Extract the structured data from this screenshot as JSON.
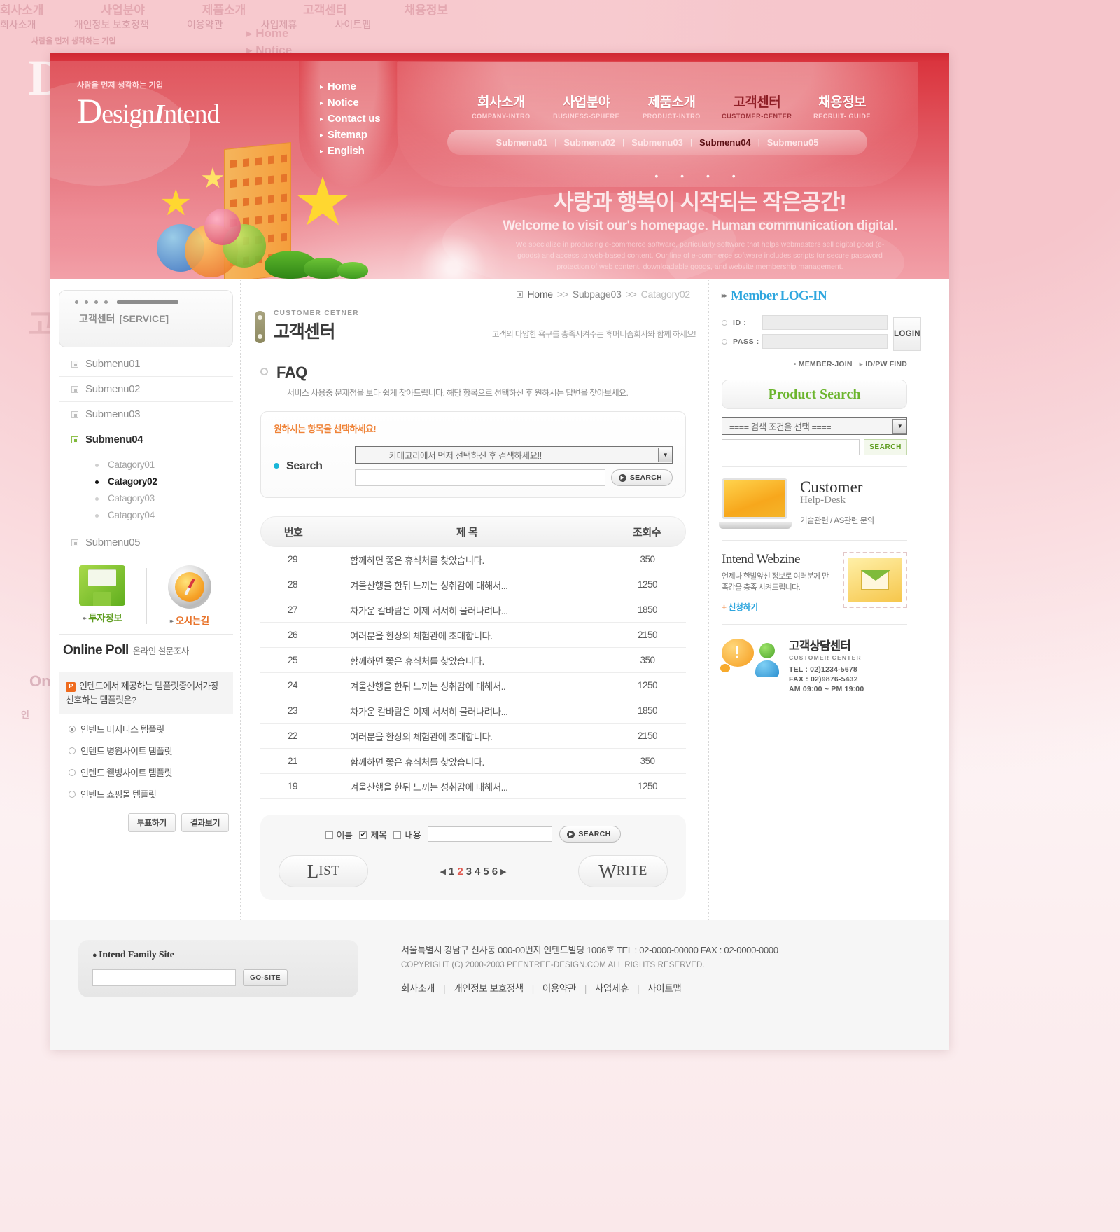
{
  "brand": {
    "tagline": "사람을 먼저 생각하는 기업",
    "name_cap": "D",
    "name_rest": "esign",
    "name_ital": "I",
    "name_tail": "ntend"
  },
  "quicknav": [
    {
      "label": "Home"
    },
    {
      "label": "Notice"
    },
    {
      "label": "Contact us"
    },
    {
      "label": "Sitemap"
    },
    {
      "label": "English"
    }
  ],
  "mainnav": [
    {
      "ko": "회사소개",
      "en": "COMPANY-INTRO",
      "active": false
    },
    {
      "ko": "사업분야",
      "en": "BUSINESS-SPHERE",
      "active": false
    },
    {
      "ko": "제품소개",
      "en": "PRODUCT-INTRO",
      "active": false
    },
    {
      "ko": "고객센터",
      "en": "CUSTOMER-CENTER",
      "active": true
    },
    {
      "ko": "채용정보",
      "en": "RECRUIT- GUIDE",
      "active": false
    }
  ],
  "subnav": [
    "Submenu01",
    "Submenu02",
    "Submenu03",
    "Submenu04",
    "Submenu05"
  ],
  "subnav_active": "Submenu04",
  "hero": {
    "dots": "• •  • •",
    "korean": "사랑과 행복이 시작되는 작은공간!",
    "english": "Welcome to visit our's homepage. Human communication digital.",
    "small": "We specialize in producing e-commerce software, particularly software that helps webmasters sell digital good (e-goods) and access to web-based content. Our line of e-commerce software includes scripts for secure password protection of web content, downloadable goods, and website membership management."
  },
  "sidebar": {
    "title_ko": "고객센터",
    "title_en": "[SERVICE]",
    "menu": [
      {
        "label": "Submenu01",
        "active": false
      },
      {
        "label": "Submenu02",
        "active": false
      },
      {
        "label": "Submenu03",
        "active": false
      },
      {
        "label": "Submenu04",
        "active": true
      }
    ],
    "categories": [
      {
        "label": "Catagory01",
        "active": false
      },
      {
        "label": "Catagory02",
        "active": true
      },
      {
        "label": "Catagory03",
        "active": false
      },
      {
        "label": "Catagory04",
        "active": false
      }
    ],
    "menu_last": {
      "label": "Submenu05",
      "active": false
    },
    "banner1_label": "투자정보",
    "banner2_label": "오시는길",
    "poll": {
      "title_en": "Online Poll",
      "title_ko": "온라인 설문조사",
      "badge": "P",
      "question": "인텐드에서 제공하는 템플릿중에서가장 선호하는 템플릿은?",
      "options": [
        {
          "label": "인텐드 비지니스 템플릿",
          "selected": true
        },
        {
          "label": "인텐드 병원사이트 템플릿",
          "selected": false
        },
        {
          "label": "인텐드 웰빙사이트 템플릿",
          "selected": false
        },
        {
          "label": "인텐드 쇼핑몰 템플릿",
          "selected": false
        }
      ],
      "vote_button": "투표하기",
      "result_button": "결과보기"
    }
  },
  "breadcrumb": {
    "home": "Home",
    "sep": ">>",
    "level2": "Subpage03",
    "level3": "Catagory02"
  },
  "page": {
    "title_en": "CUSTOMER CETNER",
    "title_ko": "고객센터",
    "desc": "고객의 다양한 욕구를 충족시켜주는 휴머니즘회사와 함께 하세요!",
    "faq_title": "FAQ",
    "faq_desc": "서비스 사용중 문제점을 보다 쉽게 찾아드립니다. 해당 항목으르 선택하신 후 원하시는 답변을 찾아보세요."
  },
  "search_panel": {
    "heading": "원하시는 항목을 선택하세요!",
    "label": "Search",
    "select_value": "=====  카테고리에서 먼저 선택하신 후 검색하세요!!  =====",
    "input_value": "",
    "button": "SEARCH"
  },
  "table": {
    "headers": {
      "no": "번호",
      "title": "제  목",
      "hits": "조회수"
    },
    "rows": [
      {
        "no": "29",
        "title": "함께하면 쫗은 휴식처를 찾았습니다.",
        "hits": "350"
      },
      {
        "no": "28",
        "title": "겨울산행을 한뒤 느끼는 성취감에 대해서...",
        "hits": "1250"
      },
      {
        "no": "27",
        "title": "차가운 칼바람은 이제 서서히 물러나려나...",
        "hits": "1850"
      },
      {
        "no": "26",
        "title": "여러분을 환상의 체험관에 초대합니다.",
        "hits": "2150"
      },
      {
        "no": "25",
        "title": "함께하면 쫗은 휴식처를 찾았습니다.",
        "hits": "350"
      },
      {
        "no": "24",
        "title": "겨울산행을 한뒤 느끼는 성취감에 대해서..",
        "hits": "1250"
      },
      {
        "no": "23",
        "title": "차가운 칼바람은 이제 서서히 물러나려나...",
        "hits": "1850"
      },
      {
        "no": "22",
        "title": "여러분을 환상의 체험관에 초대합니다.",
        "hits": "2150"
      },
      {
        "no": "21",
        "title": "함께하면 쫗은 휴식처를 찾았습니다.",
        "hits": "350"
      },
      {
        "no": "19",
        "title": "겨울산행을 한뒤 느끼는 성취감에 대해서...",
        "hits": "1250"
      }
    ]
  },
  "bottom": {
    "filters": [
      {
        "label": "이름",
        "checked": false
      },
      {
        "label": "제목",
        "checked": true
      },
      {
        "label": "내용",
        "checked": false
      }
    ],
    "input_value": "",
    "search_button": "SEARCH",
    "list_button_1": "L",
    "list_button_2": "IST",
    "write_button_1": "W",
    "write_button_2": "RITE",
    "pages": [
      "1",
      "2",
      "3",
      "4",
      "5",
      "6"
    ],
    "current_page": "2",
    "prev_arrow": "◀",
    "next_arrow": "▶"
  },
  "member": {
    "title": "Member LOG-IN",
    "id_label": "ID :",
    "pass_label": "PASS :",
    "id_value": "",
    "pass_value": "",
    "login_button": "LOGIN",
    "join_link": "MEMBER-JOIN",
    "find_link": "ID/PW FIND"
  },
  "product_search": {
    "title": "Product Search",
    "select_value": "====  검색 조건을 선택  ====",
    "input_value": "",
    "button": "SEARCH"
  },
  "helpdesk": {
    "title1": "Customer",
    "title2": "Help-Desk",
    "desc": "기술관련 / AS관련 문의"
  },
  "webzine": {
    "title": "Intend Webzine",
    "desc": "언제나 한발앞선 정보로 여러분께 만족감을 충족 시켜드립니다.",
    "link_plus": "+",
    "link": "신청하기"
  },
  "call_center": {
    "title_ko": "고객상담센터",
    "title_en": "CUSTOMER CENTER",
    "tel": "TEL : 02)1234-5678",
    "fax": "FAX : 02)9876-5432",
    "hours": "AM 09:00 ~ PM 19:00"
  },
  "footer": {
    "family_title": "Intend Family Site",
    "family_input_value": "",
    "family_button": "GO-SITE",
    "address": "서울특별시 강남구 신사동 000-00번지 인텐드빌딩 1006호  TEL : 02-0000-00000  FAX : 02-0000-0000",
    "copyright": "COPYRIGHT (C) 2000-2003 PEENTREE-DESIGN.COM  ALL RIGHTS RESERVED.",
    "links": [
      "회사소개",
      "개인정보 보호정책",
      "이용약관",
      "사업제휴",
      "사이트맵"
    ]
  },
  "ghost": {
    "tagline": "사람을 먼저 생각하는 기업",
    "D": "D",
    "home": "Home",
    "notice": "Notice",
    "nav": [
      "회사소개",
      "사업분야",
      "제품소개",
      "고객센터",
      "채용정보"
    ],
    "left_title": "고",
    "online": "On",
    "poll_q": "인",
    "footer_links": [
      "회사소개",
      "개인정보 보호정책",
      "이용약관",
      "사업제휴",
      "사이트맵"
    ]
  },
  "colors": {
    "brand_red": "#d9313b",
    "accent_orange": "#ef8338",
    "accent_blue": "#2ea6de",
    "accent_green": "#6cb52e",
    "cyan_dot": "#19b6d8"
  }
}
